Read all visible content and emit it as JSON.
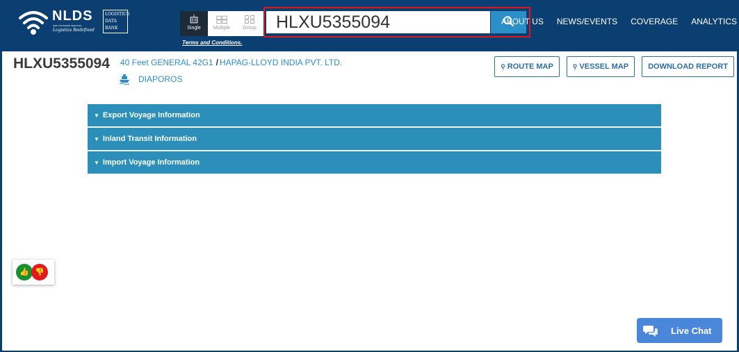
{
  "header": {
    "brand": "NLDS",
    "brand_sub1": "NEW CONTAINER SERVICES",
    "brand_tagline": "Logistics Redefined",
    "ldb": [
      "LOGISTICS",
      "DATA",
      "BANK"
    ],
    "modes": [
      {
        "label": "Single",
        "icon": "single-container-icon",
        "active": true
      },
      {
        "label": "Multiple",
        "icon": "multiple-containers-icon",
        "active": false
      },
      {
        "label": "Group",
        "icon": "group-icon",
        "active": false
      }
    ],
    "terms": "Terms and Conditions.",
    "search": {
      "value": "HLXU5355094",
      "icon": "search-icon"
    },
    "nav": [
      "ABOUT US",
      "NEWS/EVENTS",
      "COVERAGE",
      "ANALYTICS"
    ]
  },
  "container": {
    "number": "HLXU5355094",
    "type": "40 Feet GENERAL 42G1",
    "line": "HAPAG-LLOYD INDIA PVT. LTD.",
    "vessel": "DIAPOROS"
  },
  "actions": {
    "route_map": "ROUTE MAP",
    "vessel_map": "VESSEL MAP",
    "download_report": "DOWNLOAD REPORT"
  },
  "accordion": [
    "Export Voyage Information",
    "Inland Transit Information",
    "Import Voyage Information"
  ],
  "livechat": {
    "label": "Live Chat"
  },
  "colors": {
    "header_bg": "#0b3f72",
    "accent": "#2b8fca",
    "accordion_bg": "#2b8fb9",
    "search_highlight": "#e0151b",
    "thumbs_up": "#1a8f2d",
    "thumbs_down": "#e11a1a",
    "livechat_bg": "#4a86d9"
  }
}
